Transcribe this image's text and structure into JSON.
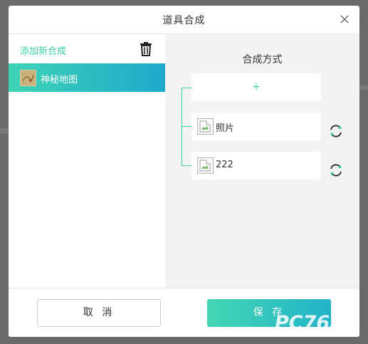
{
  "dialog": {
    "title": "道具合成",
    "close_icon": "close-icon"
  },
  "left_panel": {
    "add_label": "添加新合成",
    "delete_icon": "trash-icon",
    "items": [
      {
        "label": "神秘地图",
        "thumb_icon": "map-thumbnail"
      }
    ]
  },
  "right_panel": {
    "title": "合成方式",
    "add_slot_symbol": "+",
    "slots": [
      {
        "label": "照片",
        "image_icon": "broken-image-icon",
        "action_icon": "refresh-icon"
      },
      {
        "label": "222",
        "image_icon": "broken-image-icon",
        "action_icon": "refresh-icon"
      }
    ]
  },
  "footer": {
    "cancel_label": "取 消",
    "save_label": "保 存"
  },
  "watermark": "PC76",
  "colors": {
    "accent": "#3ccfa6",
    "gradient_start": "#3fd3b5",
    "gradient_end": "#1fa8cc"
  }
}
